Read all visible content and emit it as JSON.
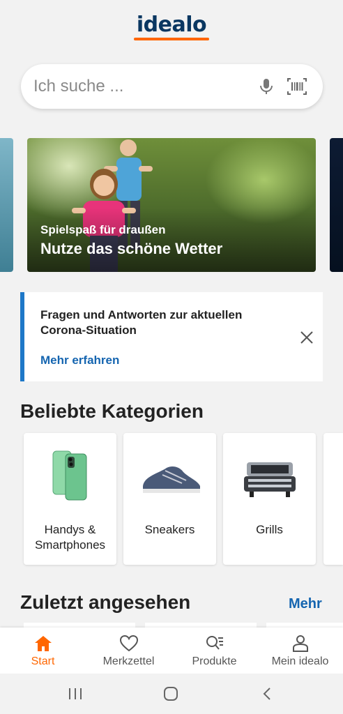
{
  "header": {
    "logo_text": "idealo"
  },
  "search": {
    "placeholder": "Ich suche ...",
    "mic_icon": "microphone-icon",
    "scan_icon": "barcode-scanner-icon"
  },
  "banner": {
    "subtitle": "Spielspaß für draußen",
    "title": "Nutze das schöne Wetter"
  },
  "notice": {
    "text": "Fragen und Antworten zur aktuellen Corona-Situation",
    "link": "Mehr erfahren",
    "close_icon": "close-icon"
  },
  "categories": {
    "title": "Beliebte Kategorien",
    "items": [
      {
        "label": "Handys & Smartphones",
        "icon": "smartphone-image"
      },
      {
        "label": "Sneakers",
        "icon": "sneaker-image"
      },
      {
        "label": "Grills",
        "icon": "grill-image"
      }
    ]
  },
  "recent": {
    "title": "Zuletzt angesehen",
    "more": "Mehr"
  },
  "bottom_nav": {
    "items": [
      {
        "label": "Start",
        "icon": "home-icon",
        "active": true
      },
      {
        "label": "Merkzettel",
        "icon": "heart-icon",
        "active": false
      },
      {
        "label": "Produkte",
        "icon": "product-search-icon",
        "active": false
      },
      {
        "label": "Mein idealo",
        "icon": "user-icon",
        "active": false
      }
    ]
  },
  "system_nav": {
    "recent_icon": "recent-apps-icon",
    "home_icon": "home-button-icon",
    "back_icon": "back-icon"
  },
  "colors": {
    "brand_blue": "#0a3761",
    "brand_orange": "#ff6600",
    "link_blue": "#1565b0",
    "accent_bar": "#1e78c8"
  }
}
